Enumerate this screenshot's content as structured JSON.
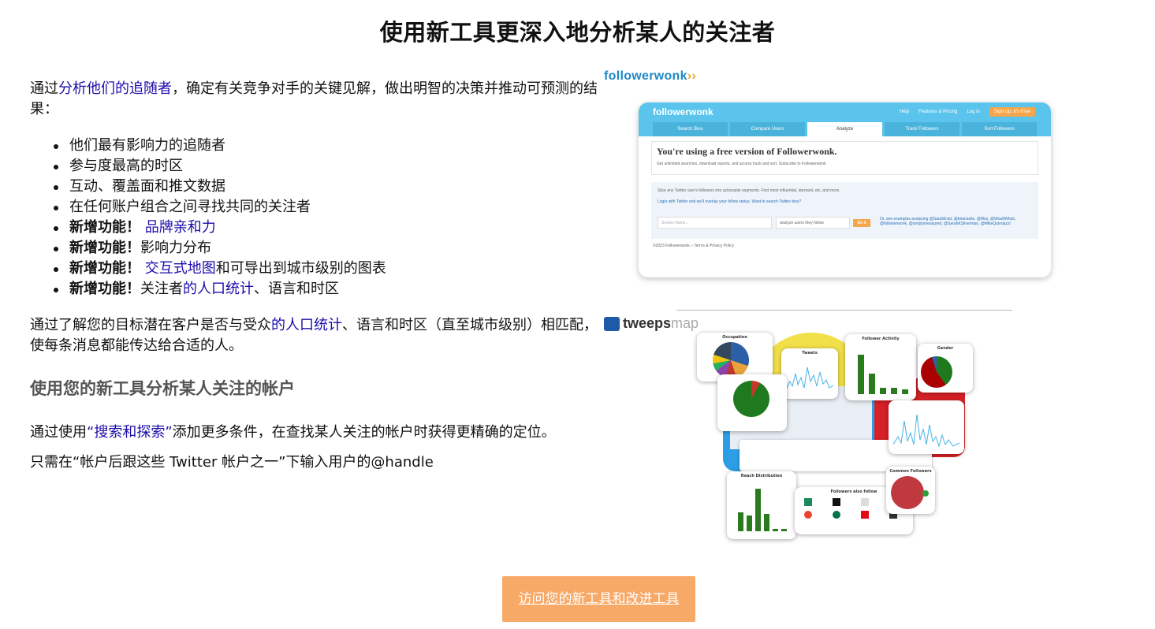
{
  "title": "使用新工具更深入地分析某人的关注者",
  "intro": {
    "prefix": "通过",
    "link": "分析他们的追随者",
    "suffix": "，确定有关竞争对手的关键见解，做出明智的决策并推动可预测的结果："
  },
  "features": [
    {
      "text": "他们最有影响力的追随者"
    },
    {
      "text": "参与度最高的时区"
    },
    {
      "text": "互动、覆盖面和推文数据"
    },
    {
      "text": "在任何账户组合之间寻找共同的关注者"
    },
    {
      "bold": "新增功能！",
      "link": " 品牌亲和力"
    },
    {
      "bold": "新增功能！",
      "text": "影响力分布"
    },
    {
      "bold": "新增功能！",
      "link": " 交互式地图",
      "text2": "和可导出到城市级别的图表"
    },
    {
      "bold": "新增功能！",
      "text": "关注者",
      "link": "的人口统计",
      "text2": "、语言和时区"
    }
  ],
  "para2": {
    "prefix": "通过了解您的目标潜在客户是否与受众",
    "link": "的人口统计",
    "suffix": "、语言和时区（直至城市级别）相匹配，使每条消息都能传达给合适的人。"
  },
  "subheading": "使用您的新工具分析某人关注的帐户",
  "para3": {
    "prefix": "通过使用",
    "link": "“搜索和探索”",
    "suffix": "添加更多条件，在查找某人关注的帐户时获得更精确的定位。"
  },
  "para4": "只需在“帐户后跟这些 Twitter 帐户之一”下输入用户的@handle",
  "followerwonk": {
    "logo_text": "followerwonk",
    "logo_arrows": "››",
    "brand": "followerwonk",
    "nav": [
      "Help",
      "Features & Pricing",
      "Log in"
    ],
    "signup": "Sign Up, It's Free",
    "tabs": [
      "Search Bios",
      "Compare Users",
      "Analyze",
      "Track Followers",
      "Sort Followers"
    ],
    "active_tab": "Analyze",
    "notice_heading": "You're using a free version of Followerwonk.",
    "notice_sub": "Get unlimited searches, download reports, and access track and sort. Subscribe to Followerwonk",
    "box_line1": "Slice any Twitter user's followers into actionable segments. Find most influential, dormant, etc, and more.",
    "box_line2": "Login with Twitter and we'll overlay your follow status. Want to search Twitter bios?",
    "input_placeholder": "Screen Name...",
    "select_value": "analyze users they follow",
    "go_label": "Do it",
    "examples": "Or, see examples analyzing @SarahEvid, @briansolis, @Moz, @WouftWhair, @followerwonk, @simplymeasured, @SarahKSilverman, @MikeQuindazzi",
    "footer": "©2023 Followerwonk – Terms & Privacy Policy"
  },
  "tweepsmap": {
    "logo_a": "tweeps",
    "logo_b": "map",
    "cards": [
      "Occupation",
      "Tweets",
      "Follower Activity",
      "Gender",
      "Reach Distribution",
      "Followers also follow",
      "Common Followers"
    ]
  },
  "cta_label": "访问您的新工具和改进工具",
  "colors": {
    "link": "#1a0dab",
    "cta": "#f7a968",
    "fw_blue": "#5bc4ec",
    "tm_green": "#2a7a1e"
  }
}
